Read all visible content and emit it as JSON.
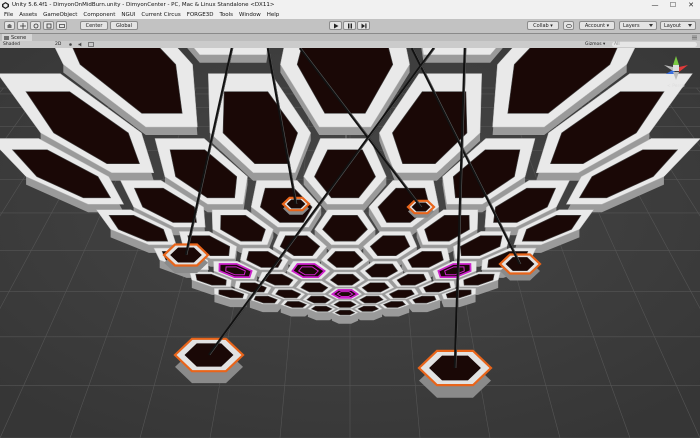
{
  "window": {
    "title": "Unity 5.6.4f1 - DimyonOnMidBurn.unity - DimyonCenter - PC, Mac & Linux Standalone <DX11>",
    "minimize": "—",
    "maximize": "☐",
    "close": "✕"
  },
  "menu": [
    "File",
    "Assets",
    "GameObject",
    "Component",
    "NGUI",
    "Current Circus",
    "FORGE3D",
    "Tools",
    "Window",
    "Help"
  ],
  "toolbar": {
    "pivot_label": "Center",
    "space_label": "Global",
    "collab_label": "Collab ▾",
    "account_label": "Account ▾",
    "layers_label": "Layers",
    "layout_label": "Layout"
  },
  "scene": {
    "tab_label": "Scene",
    "shading_mode": "Shaded",
    "mode_2d": "2D",
    "gizmos_label": "Gizmos ▾",
    "search_placeholder": "All",
    "persp_label": "< Persp"
  },
  "colors": {
    "accent_orange": "#e8641a",
    "accent_magenta": "#cc22cc",
    "background": "#3d3d3d",
    "hex_fill": "#1a0806"
  }
}
